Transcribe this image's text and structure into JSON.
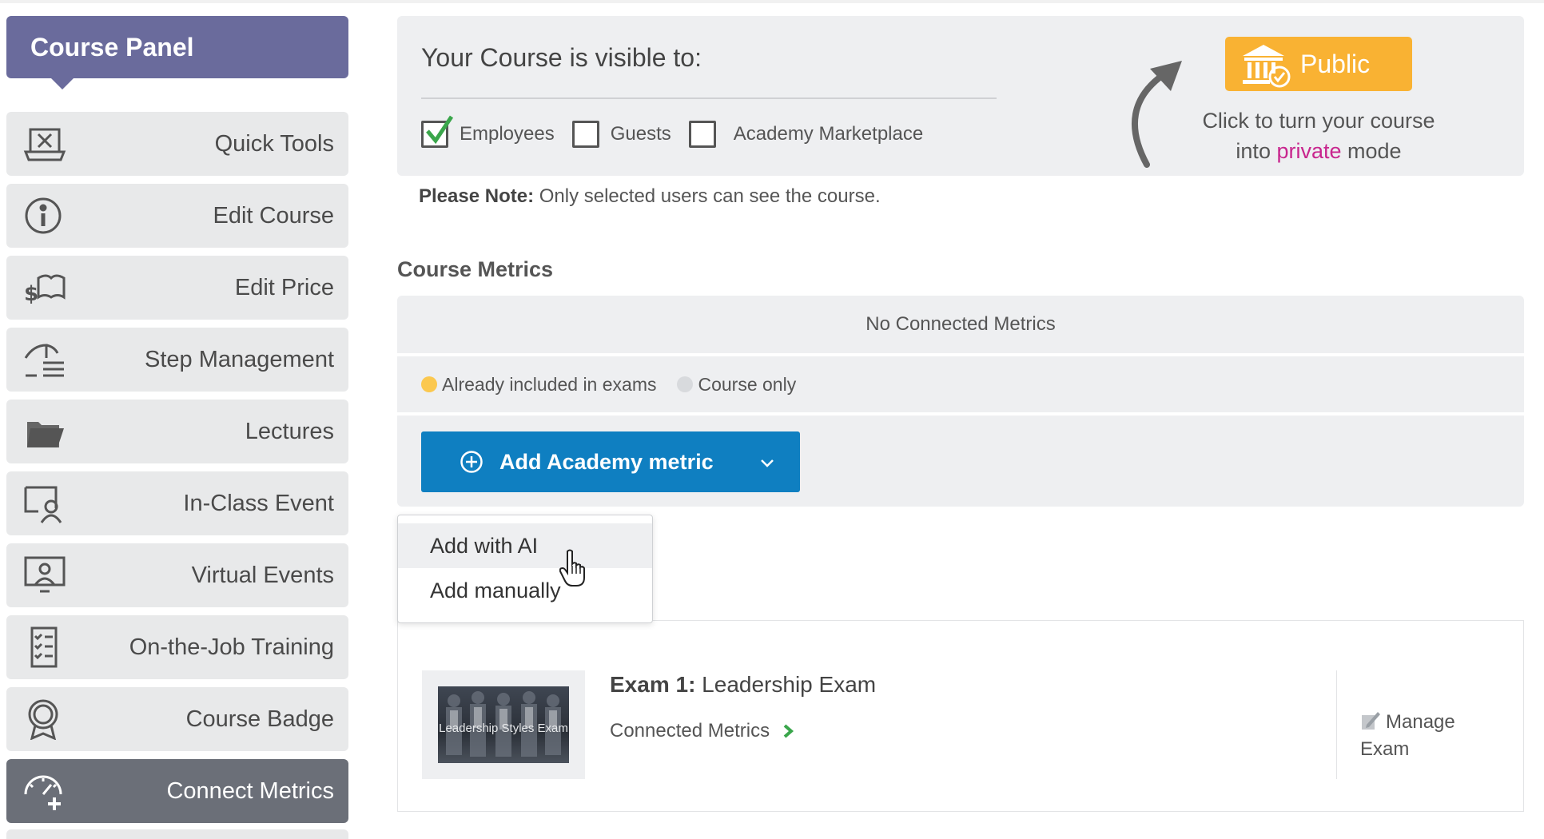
{
  "sidebar": {
    "title": "Course Panel",
    "items": [
      {
        "label": "Quick Tools",
        "icon": "quick-tools-icon"
      },
      {
        "label": "Edit Course",
        "icon": "info-icon"
      },
      {
        "label": "Edit Price",
        "icon": "price-book-icon"
      },
      {
        "label": "Step Management",
        "icon": "step-management-icon"
      },
      {
        "label": "Lectures",
        "icon": "folder-icon"
      },
      {
        "label": "In-Class Event",
        "icon": "in-class-event-icon"
      },
      {
        "label": "Virtual Events",
        "icon": "virtual-events-icon"
      },
      {
        "label": "On-the-Job Training",
        "icon": "checklist-icon"
      },
      {
        "label": "Course Badge",
        "icon": "badge-icon"
      },
      {
        "label": "Connect Metrics",
        "icon": "speedometer-plus-icon",
        "active": true
      }
    ]
  },
  "visibility": {
    "title": "Your Course is visible to:",
    "options": [
      {
        "label": "Employees",
        "checked": true
      },
      {
        "label": "Guests",
        "checked": false
      },
      {
        "label": "Academy Marketplace",
        "checked": false
      }
    ],
    "public_button": "Public",
    "hint_before": "Click to turn your course into ",
    "hint_highlight": "private",
    "hint_after": " mode",
    "highlight_color": "#c8268e",
    "button_color": "#f9b233"
  },
  "note": {
    "bold": "Please Note:",
    "text": " Only selected users can see the course."
  },
  "metrics": {
    "section_title": "Course Metrics",
    "empty_text": "No Connected Metrics",
    "legend": [
      {
        "label": "Already included in exams",
        "color": "#fbc84f"
      },
      {
        "label": "Course only",
        "color": "#d8dadd"
      }
    ],
    "add_button": "Add Academy metric",
    "add_button_color": "#0f7fc1",
    "dropdown": [
      "Add with AI",
      "Add manually"
    ]
  },
  "exam": {
    "prefix": "Exam 1:",
    "name": " Leadership Exam",
    "thumbnail_text": "Leadership Styles Exam",
    "connected_label": "Connected Metrics",
    "manage_label": "Manage Exam"
  }
}
